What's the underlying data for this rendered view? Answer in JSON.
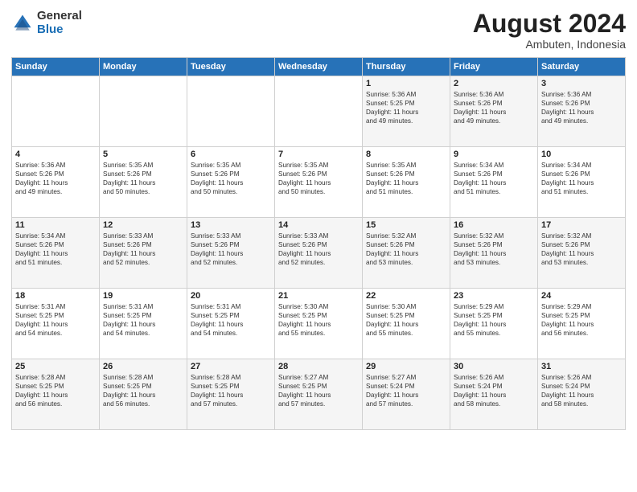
{
  "logo": {
    "general": "General",
    "blue": "Blue"
  },
  "title": "August 2024",
  "location": "Ambuten, Indonesia",
  "days_of_week": [
    "Sunday",
    "Monday",
    "Tuesday",
    "Wednesday",
    "Thursday",
    "Friday",
    "Saturday"
  ],
  "weeks": [
    [
      {
        "day": "",
        "content": ""
      },
      {
        "day": "",
        "content": ""
      },
      {
        "day": "",
        "content": ""
      },
      {
        "day": "",
        "content": ""
      },
      {
        "day": "1",
        "content": "Sunrise: 5:36 AM\nSunset: 5:25 PM\nDaylight: 11 hours\nand 49 minutes."
      },
      {
        "day": "2",
        "content": "Sunrise: 5:36 AM\nSunset: 5:26 PM\nDaylight: 11 hours\nand 49 minutes."
      },
      {
        "day": "3",
        "content": "Sunrise: 5:36 AM\nSunset: 5:26 PM\nDaylight: 11 hours\nand 49 minutes."
      }
    ],
    [
      {
        "day": "4",
        "content": "Sunrise: 5:36 AM\nSunset: 5:26 PM\nDaylight: 11 hours\nand 49 minutes."
      },
      {
        "day": "5",
        "content": "Sunrise: 5:35 AM\nSunset: 5:26 PM\nDaylight: 11 hours\nand 50 minutes."
      },
      {
        "day": "6",
        "content": "Sunrise: 5:35 AM\nSunset: 5:26 PM\nDaylight: 11 hours\nand 50 minutes."
      },
      {
        "day": "7",
        "content": "Sunrise: 5:35 AM\nSunset: 5:26 PM\nDaylight: 11 hours\nand 50 minutes."
      },
      {
        "day": "8",
        "content": "Sunrise: 5:35 AM\nSunset: 5:26 PM\nDaylight: 11 hours\nand 51 minutes."
      },
      {
        "day": "9",
        "content": "Sunrise: 5:34 AM\nSunset: 5:26 PM\nDaylight: 11 hours\nand 51 minutes."
      },
      {
        "day": "10",
        "content": "Sunrise: 5:34 AM\nSunset: 5:26 PM\nDaylight: 11 hours\nand 51 minutes."
      }
    ],
    [
      {
        "day": "11",
        "content": "Sunrise: 5:34 AM\nSunset: 5:26 PM\nDaylight: 11 hours\nand 51 minutes."
      },
      {
        "day": "12",
        "content": "Sunrise: 5:33 AM\nSunset: 5:26 PM\nDaylight: 11 hours\nand 52 minutes."
      },
      {
        "day": "13",
        "content": "Sunrise: 5:33 AM\nSunset: 5:26 PM\nDaylight: 11 hours\nand 52 minutes."
      },
      {
        "day": "14",
        "content": "Sunrise: 5:33 AM\nSunset: 5:26 PM\nDaylight: 11 hours\nand 52 minutes."
      },
      {
        "day": "15",
        "content": "Sunrise: 5:32 AM\nSunset: 5:26 PM\nDaylight: 11 hours\nand 53 minutes."
      },
      {
        "day": "16",
        "content": "Sunrise: 5:32 AM\nSunset: 5:26 PM\nDaylight: 11 hours\nand 53 minutes."
      },
      {
        "day": "17",
        "content": "Sunrise: 5:32 AM\nSunset: 5:26 PM\nDaylight: 11 hours\nand 53 minutes."
      }
    ],
    [
      {
        "day": "18",
        "content": "Sunrise: 5:31 AM\nSunset: 5:25 PM\nDaylight: 11 hours\nand 54 minutes."
      },
      {
        "day": "19",
        "content": "Sunrise: 5:31 AM\nSunset: 5:25 PM\nDaylight: 11 hours\nand 54 minutes."
      },
      {
        "day": "20",
        "content": "Sunrise: 5:31 AM\nSunset: 5:25 PM\nDaylight: 11 hours\nand 54 minutes."
      },
      {
        "day": "21",
        "content": "Sunrise: 5:30 AM\nSunset: 5:25 PM\nDaylight: 11 hours\nand 55 minutes."
      },
      {
        "day": "22",
        "content": "Sunrise: 5:30 AM\nSunset: 5:25 PM\nDaylight: 11 hours\nand 55 minutes."
      },
      {
        "day": "23",
        "content": "Sunrise: 5:29 AM\nSunset: 5:25 PM\nDaylight: 11 hours\nand 55 minutes."
      },
      {
        "day": "24",
        "content": "Sunrise: 5:29 AM\nSunset: 5:25 PM\nDaylight: 11 hours\nand 56 minutes."
      }
    ],
    [
      {
        "day": "25",
        "content": "Sunrise: 5:28 AM\nSunset: 5:25 PM\nDaylight: 11 hours\nand 56 minutes."
      },
      {
        "day": "26",
        "content": "Sunrise: 5:28 AM\nSunset: 5:25 PM\nDaylight: 11 hours\nand 56 minutes."
      },
      {
        "day": "27",
        "content": "Sunrise: 5:28 AM\nSunset: 5:25 PM\nDaylight: 11 hours\nand 57 minutes."
      },
      {
        "day": "28",
        "content": "Sunrise: 5:27 AM\nSunset: 5:25 PM\nDaylight: 11 hours\nand 57 minutes."
      },
      {
        "day": "29",
        "content": "Sunrise: 5:27 AM\nSunset: 5:24 PM\nDaylight: 11 hours\nand 57 minutes."
      },
      {
        "day": "30",
        "content": "Sunrise: 5:26 AM\nSunset: 5:24 PM\nDaylight: 11 hours\nand 58 minutes."
      },
      {
        "day": "31",
        "content": "Sunrise: 5:26 AM\nSunset: 5:24 PM\nDaylight: 11 hours\nand 58 minutes."
      }
    ]
  ]
}
